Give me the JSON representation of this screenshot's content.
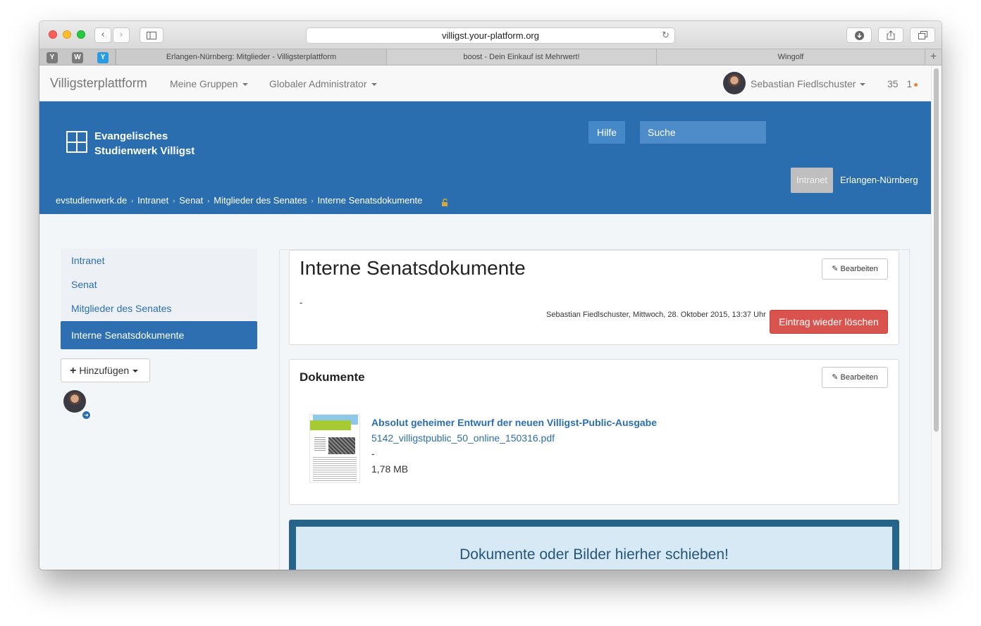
{
  "browser": {
    "url": "villigst.your-platform.org",
    "back_icon": "‹",
    "forward_icon": "›",
    "pinned_tabs": [
      {
        "label": "Y",
        "color": "#7a7a7a"
      },
      {
        "label": "W",
        "color": "#7a7a7a"
      },
      {
        "label": "Y",
        "color": "#2a9be0"
      }
    ],
    "tabs": [
      {
        "title": "Erlangen-Nürnberg: Mitglieder - Villigsterplattform"
      },
      {
        "title": "boost - Dein Einkauf ist Mehrwert!"
      },
      {
        "title": "Wingolf"
      }
    ]
  },
  "navbar": {
    "brand": "Villigsterplattform",
    "items": [
      {
        "label": "Meine Gruppen"
      },
      {
        "label": "Globaler Administrator"
      }
    ],
    "user_name": "Sebastian Fiedlschuster",
    "count_a": "35",
    "count_b": "1"
  },
  "header": {
    "logo_line1": "Evangelisches",
    "logo_line2": "Studienwerk Villigst",
    "help_label": "Hilfe",
    "search_placeholder": "Suche",
    "tabs": [
      {
        "label": "Intranet",
        "active": true
      },
      {
        "label": "Erlangen-Nürnberg",
        "active": false
      }
    ],
    "breadcrumb": [
      "evstudienwerk.de",
      "Intranet",
      "Senat",
      "Mitglieder des Senates",
      "Interne Senatsdokumente"
    ],
    "breadcrumb_separator": "›"
  },
  "sidebar": {
    "items": [
      {
        "label": "Intranet",
        "active": false
      },
      {
        "label": "Senat",
        "active": false
      },
      {
        "label": "Mitglieder des Senates",
        "active": false
      },
      {
        "label": "Interne Senatsdokumente",
        "active": true
      }
    ],
    "add_label": "Hinzufügen"
  },
  "main": {
    "title": "Interne Senatsdokumente",
    "edit_label": "Bearbeiten",
    "content_text": "-",
    "meta": "Sebastian Fiedlschuster, Mittwoch, 28. Oktober 2015, 13:37 Uhr",
    "delete_label": "Eintrag wieder löschen",
    "documents": {
      "title": "Dokumente",
      "edit_label": "Bearbeiten",
      "items": [
        {
          "title": "Absolut geheimer Entwurf der neuen Villigst-Public-Ausgabe",
          "filename": "5142_villigstpublic_50_online_150316.pdf",
          "description": "-",
          "size": "1,78 MB"
        }
      ]
    },
    "dropzone_label": "Dokumente oder Bilder hierher schieben!"
  },
  "colors": {
    "header_blue": "#2a6eb0",
    "danger": "#d9534f",
    "dropzone_border": "#27648a"
  }
}
